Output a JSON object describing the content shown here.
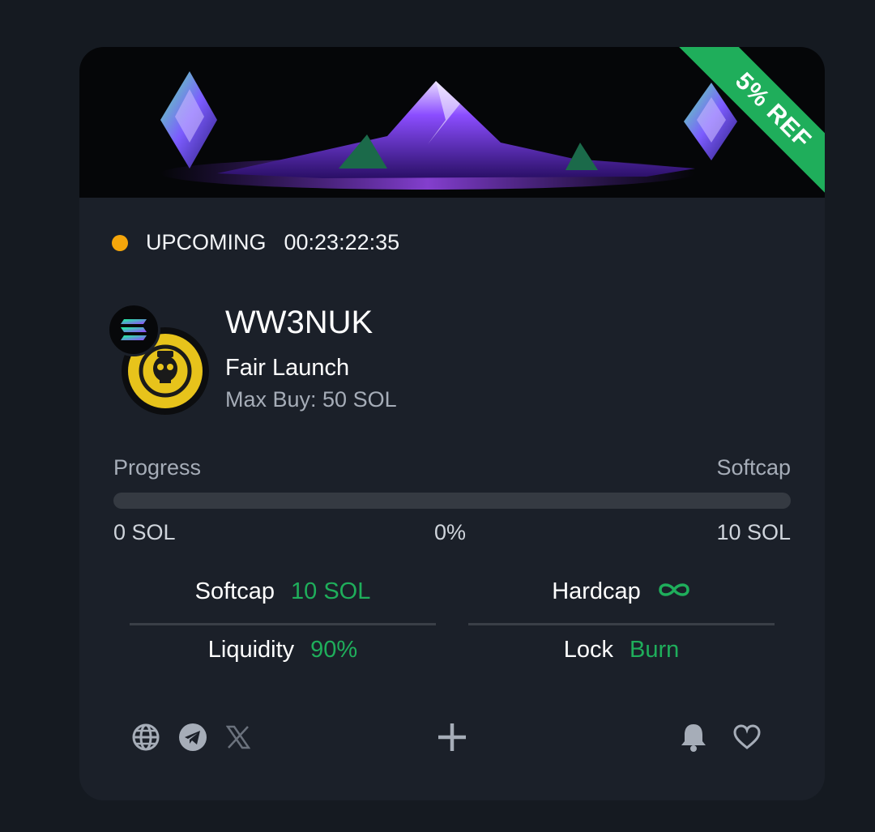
{
  "banner": {
    "ribbon_text": "5% REF"
  },
  "status": {
    "label": "UPCOMING",
    "countdown": "00:23:22:35",
    "color": "#f5a60b"
  },
  "token": {
    "name": "WW3NUK",
    "sale_type": "Fair Launch",
    "max_buy": "Max Buy: 50 SOL",
    "chain_icon": "solana-icon",
    "logo_icon": "biohazard-skull-icon"
  },
  "progress": {
    "label_left": "Progress",
    "label_right": "Softcap",
    "fraction": 0,
    "amount_current": "0 SOL",
    "percent_text": "0%",
    "amount_target": "10 SOL"
  },
  "stats": {
    "softcap_label": "Softcap",
    "softcap_value": "10 SOL",
    "hardcap_label": "Hardcap",
    "hardcap_icon": "infinity-icon",
    "liquidity_label": "Liquidity",
    "liquidity_value": "90%",
    "lock_label": "Lock",
    "lock_value": "Burn"
  },
  "footer": {
    "icons": [
      "globe-icon",
      "telegram-icon",
      "x-icon",
      "plus-icon",
      "bell-icon",
      "heart-icon"
    ]
  },
  "colors": {
    "accent_green": "#1fae5b",
    "card_bg": "#1b2029",
    "page_bg": "#151a21"
  }
}
